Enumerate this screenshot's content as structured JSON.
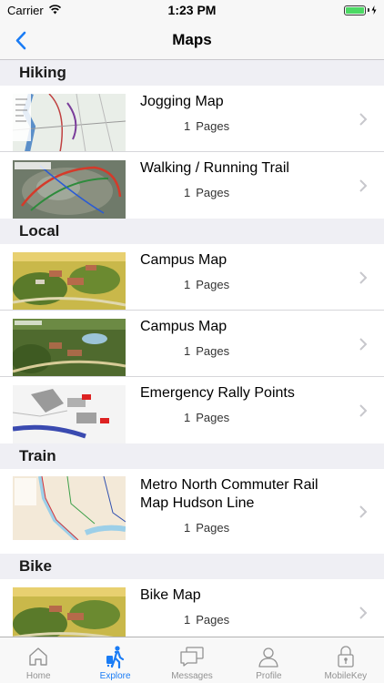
{
  "status": {
    "carrier": "Carrier",
    "time": "1:23 PM",
    "battery_level": 1.0
  },
  "nav": {
    "title": "Maps"
  },
  "sections": [
    {
      "header": "Hiking",
      "items": [
        {
          "title": "Jogging Map",
          "pages": "1",
          "pages_label": "Pages"
        },
        {
          "title": "Walking / Running Trail",
          "pages": "1",
          "pages_label": "Pages"
        }
      ]
    },
    {
      "header": "Local",
      "items": [
        {
          "title": "Campus Map",
          "pages": "1",
          "pages_label": "Pages"
        },
        {
          "title": "Campus Map",
          "pages": "1",
          "pages_label": "Pages"
        },
        {
          "title": "Emergency Rally Points",
          "pages": "1",
          "pages_label": "Pages"
        }
      ]
    },
    {
      "header": "Train",
      "items": [
        {
          "title": "Metro North Commuter Rail Map Hudson Line",
          "pages": "1",
          "pages_label": "Pages"
        }
      ]
    },
    {
      "header": "Bike",
      "items": [
        {
          "title": "Bike Map",
          "pages": "1",
          "pages_label": "Pages"
        }
      ]
    }
  ],
  "tabs": [
    {
      "label": "Home",
      "icon": "home-icon"
    },
    {
      "label": "Explore",
      "icon": "explore-icon",
      "active": true
    },
    {
      "label": "Messages",
      "icon": "messages-icon"
    },
    {
      "label": "Profile",
      "icon": "profile-icon"
    },
    {
      "label": "MobileKey",
      "icon": "lock-icon"
    }
  ],
  "colors": {
    "accent": "#1a7cf5",
    "inactive_tab": "#929292",
    "battery": "#4cd964",
    "background": "#efeff4"
  }
}
